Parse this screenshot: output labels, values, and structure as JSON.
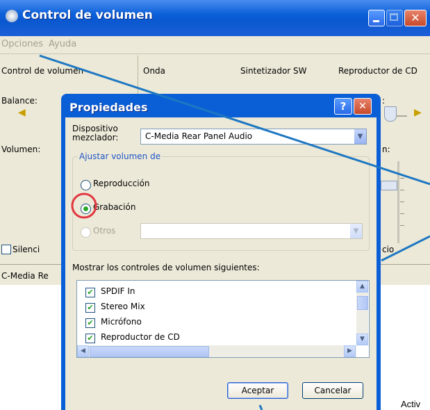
{
  "main_window": {
    "title": "Control de volumen",
    "menu": [
      "Opciones",
      "Ayuda"
    ],
    "columns": [
      "Control de volumen",
      "Onda",
      "Sintetizador SW",
      "Reproductor de CD"
    ],
    "balance_label": "Balance:",
    "volume_label": "Volumen:",
    "mute_label": "Silenci",
    "status": "C-Media Re",
    "partial_right_labels": [
      ":",
      "n:",
      "cio"
    ]
  },
  "dialog": {
    "title": "Propiedades",
    "help_glyph": "?",
    "close_glyph": "✕",
    "mixer_label": "Dispositivo mezclador:",
    "mixer_value": "C-Media Rear Panel Audio",
    "adjust_group": "Ajustar volumen de",
    "radios": [
      {
        "label": "Reproducción",
        "selected": false,
        "enabled": true
      },
      {
        "label": "Grabación",
        "selected": true,
        "enabled": true
      },
      {
        "label": "Otros",
        "selected": false,
        "enabled": false
      }
    ],
    "show_label": "Mostrar los controles de volumen siguientes:",
    "list_items": [
      {
        "label": "SPDIF In",
        "checked": true
      },
      {
        "label": "Stereo Mix",
        "checked": true
      },
      {
        "label": "Micrófono",
        "checked": true
      },
      {
        "label": "Reproductor de CD",
        "checked": true
      }
    ],
    "ok": "Aceptar",
    "cancel": "Cancelar"
  },
  "outside_text": "Activ",
  "colors": {
    "annotation_line": "#1d77c2",
    "highlight_circle": "#e2363f",
    "title_blue": "#0b5fd6"
  }
}
